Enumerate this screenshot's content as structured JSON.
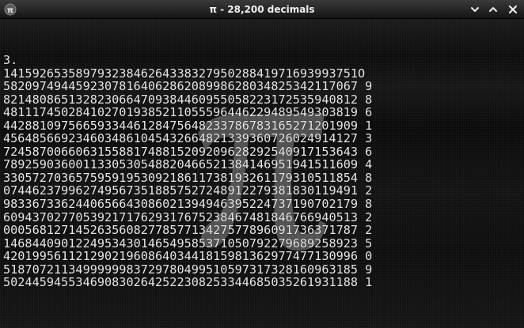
{
  "window": {
    "title": "π - 28,200 decimals",
    "app_icon": "pi-app-icon",
    "buttons": {
      "minimize_icon": "chevron-down-icon",
      "maximize_icon": "chevron-up-icon",
      "close_icon": "close-icon"
    }
  },
  "content": {
    "watermark_icon": "pi-symbol",
    "digits_text": "3.\n1415926535897932384626433832795028841971693993751O\n5820974944592307816406286208998628034825342117067 9\n8214808651328230664709384460955058223172535940812 8\n4811174502841027019385211055596446229489549303819 6\n4428810975665933446128475648233786783165271201909 1\n4564856692346034861045432664821339360726024914127 3\n7245870066063155881748815209209628292540917153643 6\n7892590360011330530548820466521384146951941511609 4\n3305727036575959195309218611738193261179310511854 8\n0744623799627495673518857527248912279381830119491 2\n9833673362440656643086021394946395224737190702179 8\n6094370277053921717629317675238467481846766940513 2\n0005681271452635608277857713427577896091736371787 2\n1468440901224953430146549585371050792279689258923 5\n4201995611212902196086403441815981362977477130996 0\n5187072113499999983729780499510597317328160963185 9\n5024459455346908302642522308253344685035261931188 1"
  }
}
